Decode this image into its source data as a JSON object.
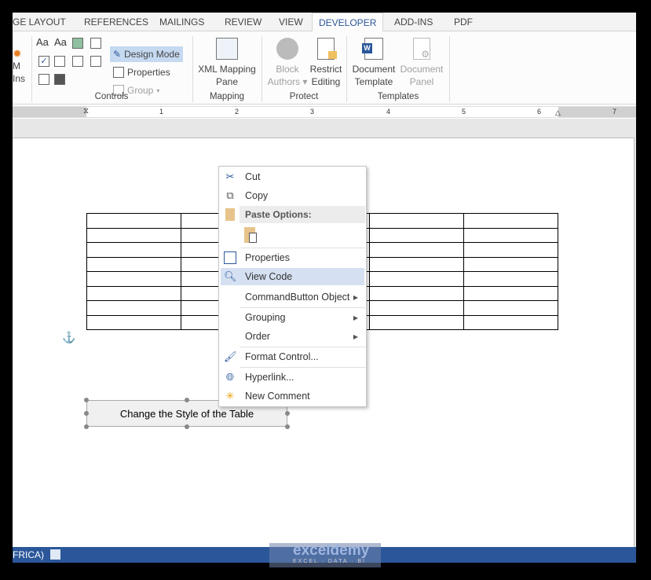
{
  "tabs": [
    {
      "label": "GE LAYOUT"
    },
    {
      "label": "REFERENCES"
    },
    {
      "label": "MAILINGS"
    },
    {
      "label": "REVIEW"
    },
    {
      "label": "VIEW"
    },
    {
      "label": "DEVELOPER",
      "active": true
    },
    {
      "label": "ADD-INS"
    },
    {
      "label": "PDF"
    }
  ],
  "ribbon": {
    "addins": {
      "line1": "M",
      "line2": "Ins"
    },
    "controls": {
      "design_mode": "Design Mode",
      "properties": "Properties",
      "group": "Group",
      "label": "Controls"
    },
    "mapping": {
      "xml_line1": "XML Mapping",
      "xml_line2": "Pane",
      "label": "Mapping"
    },
    "protect": {
      "block_line1": "Block",
      "block_line2": "Authors",
      "restrict_line1": "Restrict",
      "restrict_line2": "Editing",
      "label": "Protect"
    },
    "templates": {
      "doc_line1": "Document",
      "doc_line2": "Template",
      "panel_line1": "Document",
      "panel_line2": "Panel",
      "label": "Templates"
    }
  },
  "ruler": {
    "marks": [
      "1",
      "2",
      "3",
      "4",
      "5",
      "6",
      "7"
    ]
  },
  "document": {
    "table": {
      "rows": 8,
      "cols": 5
    },
    "command_button": "Change the Style of the Table"
  },
  "context_menu": {
    "items": [
      {
        "label": "Cut",
        "icon": "scissors-icon"
      },
      {
        "label": "Copy",
        "icon": "copy-icon"
      },
      {
        "label": "Paste Options:",
        "icon": "paste-icon",
        "header": true
      },
      {
        "label": "Properties",
        "icon": "properties-icon"
      },
      {
        "label": "View Code",
        "icon": "view-code-icon",
        "highlighted": true
      },
      {
        "label": "CommandButton Object",
        "submenu": true
      },
      {
        "label": "Grouping",
        "submenu": true
      },
      {
        "label": "Order",
        "submenu": true
      },
      {
        "label": "Format Control...",
        "icon": "format-control-icon"
      },
      {
        "label": "Hyperlink...",
        "icon": "hyperlink-icon"
      },
      {
        "label": "New Comment",
        "icon": "new-comment-icon"
      }
    ]
  },
  "status": {
    "language": "FRICA)"
  },
  "watermark": {
    "brand": "exceldemy",
    "tagline": "EXCEL · DATA · BI"
  },
  "colors": {
    "accent": "#2b579a",
    "highlight": "#d5e1f2",
    "design_mode_bg": "#c5d9f1"
  }
}
